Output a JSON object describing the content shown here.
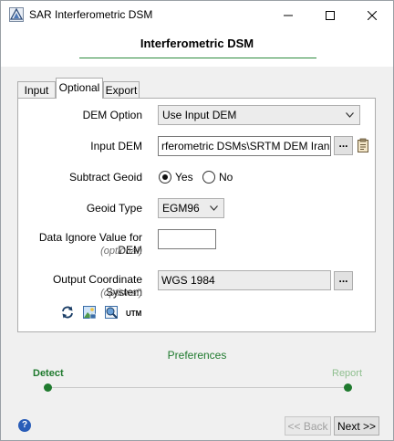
{
  "window": {
    "title": "SAR Interferometric DSM"
  },
  "header": {
    "title": "Interferometric DSM"
  },
  "tabs": [
    {
      "label": "Input"
    },
    {
      "label": "Optional",
      "active": true
    },
    {
      "label": "Export"
    }
  ],
  "form": {
    "dem_option": {
      "label": "DEM Option",
      "value": "Use Input DEM"
    },
    "input_dem": {
      "label": "Input DEM",
      "value": "rferometric DSMs\\SRTM DEM Iran.dat",
      "browse_label": "..."
    },
    "subtract_geoid": {
      "label": "Subtract Geoid",
      "yes_label": "Yes",
      "no_label": "No",
      "selected": "Yes"
    },
    "geoid_type": {
      "label": "Geoid Type",
      "value": "EGM96"
    },
    "ignore_value": {
      "label": "Data Ignore Value for DEM",
      "sublabel": "(optional)",
      "value": ""
    },
    "output_cs": {
      "label": "Output Coordinate System",
      "sublabel": "(optional)",
      "value": "WGS 1984",
      "browse_label": "..."
    },
    "cs_tools": {
      "utm_label": "UTM"
    }
  },
  "footer": {
    "preferences_label": "Preferences",
    "steps": [
      {
        "label": "Detect",
        "state": "current"
      },
      {
        "label": "Report",
        "state": "pending"
      }
    ],
    "back_label": "<< Back",
    "next_label": "Next >>",
    "help_glyph": "?"
  },
  "colors": {
    "accent_green": "#1f7a2e",
    "help_blue": "#2a5db8"
  }
}
